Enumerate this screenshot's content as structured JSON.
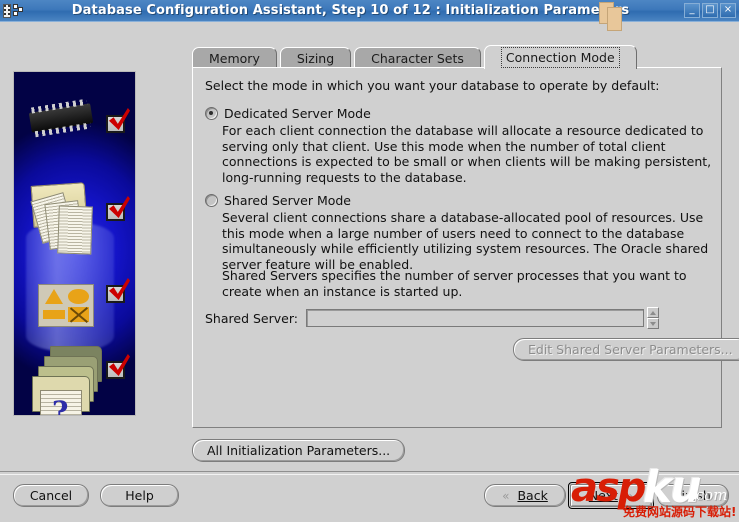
{
  "window": {
    "title": "Database Configuration Assistant, Step 10 of 12 : Initialization Parameters",
    "icon": "film-strip-icon",
    "minimize_label": "_",
    "maximize_label": "□",
    "close_label": "×"
  },
  "tabs": [
    {
      "label": "Memory",
      "active": false
    },
    {
      "label": "Sizing",
      "active": false
    },
    {
      "label": "Character Sets",
      "active": false
    },
    {
      "label": "Connection Mode",
      "active": true
    }
  ],
  "content": {
    "intro": "Select the mode in which you want your database to operate by default:",
    "options": [
      {
        "label": "Dedicated Server Mode",
        "selected": true,
        "description": "For each client connection the database will allocate a resource dedicated to serving only that client.  Use this mode when the number of total client connections is expected to be small or when clients will be making persistent, long-running requests to the database."
      },
      {
        "label": "Shared Server Mode",
        "selected": false,
        "description": "Several client connections share a database-allocated pool of resources.  Use this mode when a large number of users need to connect to the database simultaneously while efficiently utilizing system resources.  The Oracle shared server feature will be enabled."
      }
    ],
    "note": "Shared Servers specifies the number of server processes that you want to create when an instance is started up.",
    "shared_server": {
      "label": "Shared Server:",
      "value": "",
      "placeholder": "",
      "spinner_up_icon": "caret-up-icon",
      "spinner_down_icon": "caret-down-icon"
    },
    "edit_shared_button": {
      "label": "Edit Shared Server Parameters...",
      "disabled": true
    },
    "all_init_button": {
      "label": "All Initialization Parameters..."
    }
  },
  "footer": {
    "cancel_label": "Cancel",
    "help_label": "Help",
    "back_label": "Back",
    "back_icon": "chevron-left-icon",
    "next_label": "Next",
    "next_icon": "chevron-right-icon",
    "finish_label": "Finish"
  },
  "watermark": {
    "part1": "asp",
    "part2": "ku",
    "part3": ".com",
    "tagline": "免费网站源码下载站!"
  },
  "sidebar": {
    "image_alt": "oracle-database-configuration-illustration",
    "check_count": 4,
    "question_mark": "?"
  },
  "colors": {
    "titlebar": "#3d78ba",
    "background": "#d0d0d0",
    "sidebar_blue": "#1414c8",
    "check_red": "#cc0000",
    "watermark_red": "#d81e06"
  }
}
